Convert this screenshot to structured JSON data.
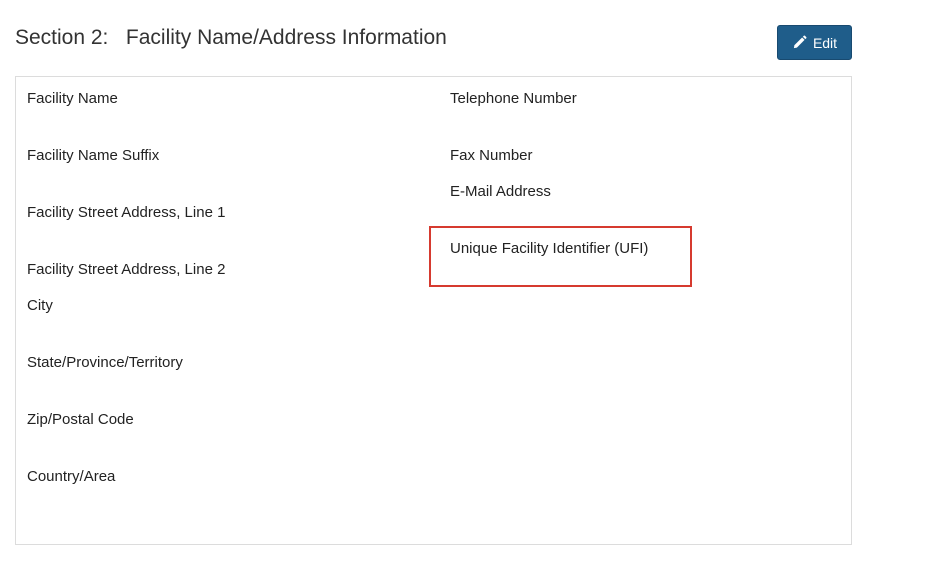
{
  "section": {
    "title": "Section 2:   Facility Name/Address Information",
    "edit_label": "Edit"
  },
  "left_fields": [
    "Facility Name",
    "Facility Name Suffix",
    "Facility Street Address, Line 1",
    "Facility Street Address, Line 2",
    "City",
    "State/Province/Territory",
    "Zip/Postal Code",
    "Country/Area"
  ],
  "right_fields": [
    "Telephone Number",
    "Fax Number",
    "E-Mail Address",
    "Unique Facility Identifier (UFI)"
  ],
  "colors": {
    "button_bg": "#1f5d8a",
    "highlight_border": "#d63a2f"
  },
  "icons": {
    "edit": "pencil-icon"
  }
}
